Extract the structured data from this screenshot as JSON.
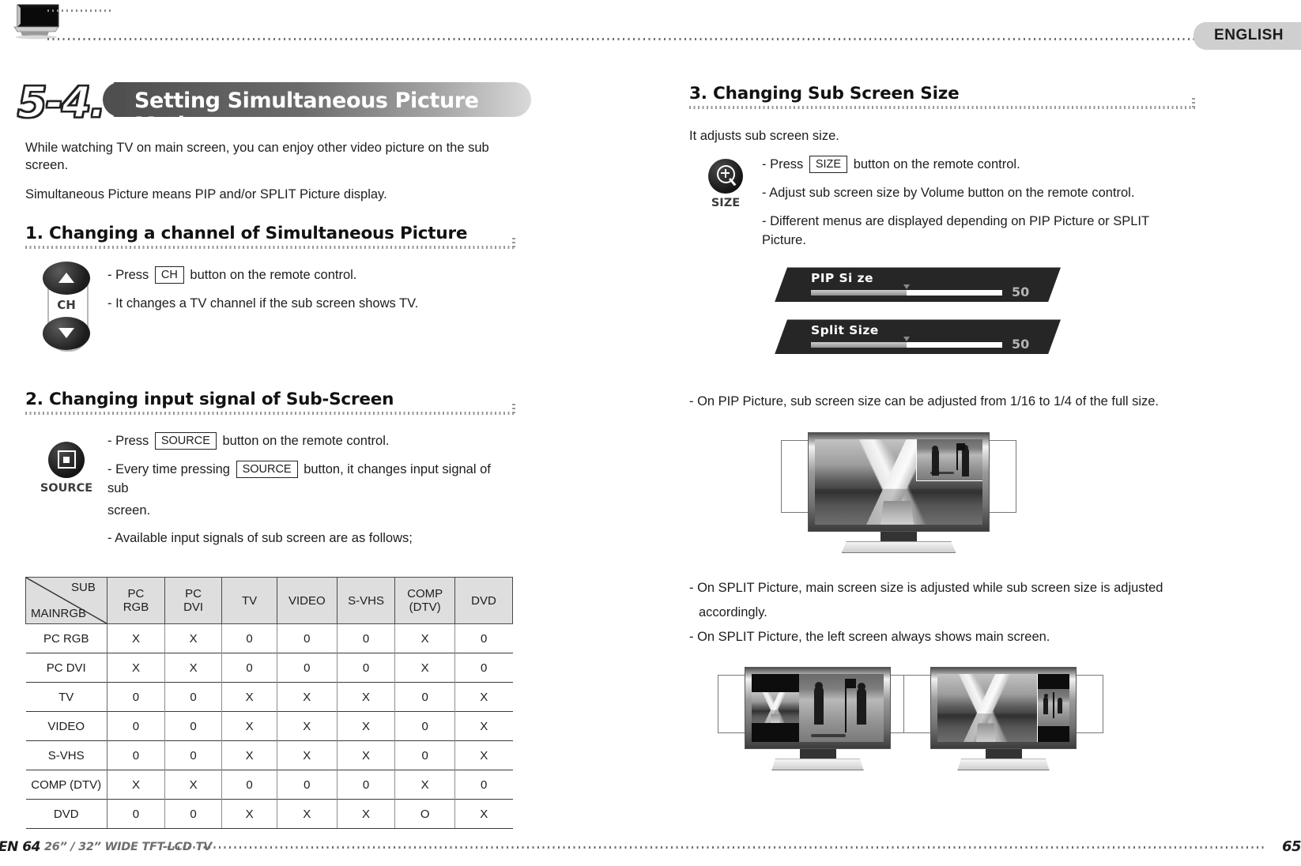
{
  "header": {
    "language_tab": "ENGLISH",
    "tv_icon": "tv-icon"
  },
  "chapter": {
    "number": "5-4.",
    "title": "Setting Simultaneous Picture Mode"
  },
  "intro": {
    "line1": "While watching TV on main screen, you can enjoy other video picture on the sub screen.",
    "line2": "Simultaneous Picture means PIP and/or SPLIT Picture display."
  },
  "section1": {
    "heading": "1. Changing a channel of Simultaneous Picture",
    "key_label": "CH",
    "bullets": [
      {
        "pre": "- Press ",
        "key": "CH",
        "post": " button on the remote control."
      },
      {
        "pre": "- It changes a TV channel if the sub screen shows TV.",
        "key": "",
        "post": ""
      }
    ],
    "bullet1_pre": "- Press",
    "bullet1_key": "CH",
    "bullet1_post": "button on the remote control.",
    "bullet2": "- It changes a TV channel if the sub screen shows TV."
  },
  "section2": {
    "heading": "2. Changing input signal of Sub-Screen",
    "key_label": "SOURCE",
    "bullet1_pre": "- Press",
    "bullet1_key": "SOURCE",
    "bullet1_post": "button on the remote control.",
    "bullet2_pre": "- Every  time  pressing",
    "bullet2_key": "SOURCE",
    "bullet2_post": "button,  it  changes  input  signal  of  sub",
    "bullet2_cont": "screen.",
    "bullet3": "- Available input signals of sub screen are as follows;"
  },
  "table": {
    "corner_sub": "SUB",
    "corner_main": "MAINRGB",
    "columns": [
      {
        "l1": "PC",
        "l2": "RGB"
      },
      {
        "l1": "PC",
        "l2": "DVI"
      },
      {
        "l1": "TV",
        "l2": ""
      },
      {
        "l1": "VIDEO",
        "l2": ""
      },
      {
        "l1": "S-VHS",
        "l2": ""
      },
      {
        "l1": "COMP",
        "l2": "(DTV)"
      },
      {
        "l1": "DVD",
        "l2": ""
      }
    ],
    "rows": [
      {
        "label": "PC RGB",
        "cells": [
          "X",
          "X",
          "0",
          "0",
          "0",
          "X",
          "0"
        ]
      },
      {
        "label": "PC DVI",
        "cells": [
          "X",
          "X",
          "0",
          "0",
          "0",
          "X",
          "0"
        ]
      },
      {
        "label": "TV",
        "cells": [
          "0",
          "0",
          "X",
          "X",
          "X",
          "0",
          "X"
        ]
      },
      {
        "label": "VIDEO",
        "cells": [
          "0",
          "0",
          "X",
          "X",
          "X",
          "0",
          "X"
        ]
      },
      {
        "label": "S-VHS",
        "cells": [
          "0",
          "0",
          "X",
          "X",
          "X",
          "0",
          "X"
        ]
      },
      {
        "label": "COMP (DTV)",
        "cells": [
          "X",
          "X",
          "0",
          "0",
          "0",
          "X",
          "0"
        ]
      },
      {
        "label": "DVD",
        "cells": [
          "0",
          "0",
          "X",
          "X",
          "X",
          "O",
          "X"
        ]
      }
    ]
  },
  "section3": {
    "heading": "3. Changing Sub Screen Size",
    "lead": "It adjusts sub screen size.",
    "key_label": "SIZE",
    "bullet1_pre": "- Press",
    "bullet1_key": "SIZE",
    "bullet1_post": "button on the remote control.",
    "bullet2": "- Adjust sub screen size by Volume button on the remote control.",
    "bullet3": "- Different menus are displayed depending on PIP Picture or SPLIT Picture.",
    "osd": [
      {
        "title": "PIP Si ze",
        "value": "50",
        "percent": 50
      },
      {
        "title": "Split Size",
        "value": "50",
        "percent": 50
      }
    ],
    "note_pip": "- On PIP Picture, sub screen size can be adjusted from 1/16 to 1/4 of the full size.",
    "note_split_1": "- On  SPLIT  Picture,  main  screen  size  is  adjusted  while  sub  screen  size  is  adjusted",
    "note_split_1b": "accordingly.",
    "note_split_2": "- On SPLIT Picture, the left screen always shows main screen."
  },
  "footer": {
    "en_page": "EN 64",
    "model": "26” / 32” WIDE TFT-LCD TV",
    "page": "65"
  }
}
